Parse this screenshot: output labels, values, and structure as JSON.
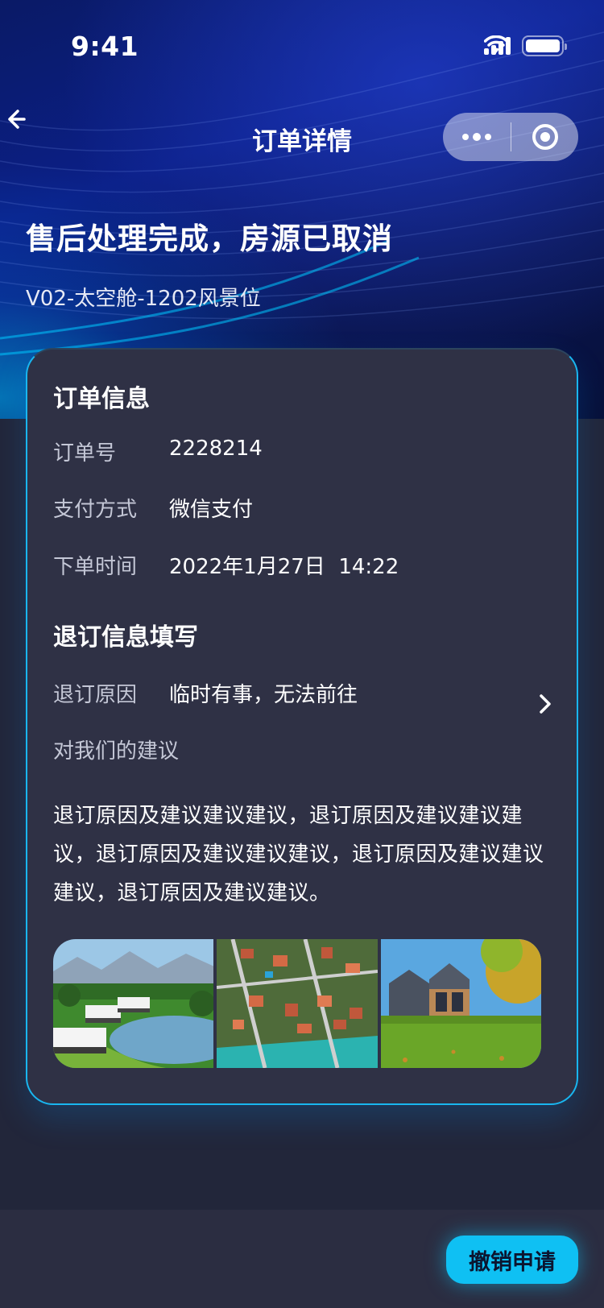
{
  "status_bar": {
    "time": "9:41"
  },
  "nav": {
    "title": "订单详情"
  },
  "header": {
    "headline": "售后处理完成，房源已取消",
    "subtitle": "V02-太空舱-1202风景位"
  },
  "order_info": {
    "title": "订单信息",
    "rows": [
      {
        "label": "订单号",
        "value": "2228214"
      },
      {
        "label": "支付方式",
        "value": "微信支付"
      },
      {
        "label": "下单时间",
        "value": "2022年1月27日  14:22"
      }
    ]
  },
  "refund": {
    "title": "退订信息填写",
    "reason_label": "退订原因",
    "reason_value": "临时有事，无法前往",
    "suggestion_label": "对我们的建议",
    "suggestion_text": "退订原因及建议建议建议，退订原因及建议建议建议，退订原因及建议建议建议，退订原因及建议建议建议，退订原因及建议建议。"
  },
  "photos": [
    "lakeside-cabins-photo",
    "aerial-town-photo",
    "modern-house-photo"
  ],
  "actions": {
    "cancel_application": "撤销申请"
  },
  "colors": {
    "accent": "#0fc0f3",
    "card_bg": "#2f3145",
    "page_bg": "#22263a"
  }
}
